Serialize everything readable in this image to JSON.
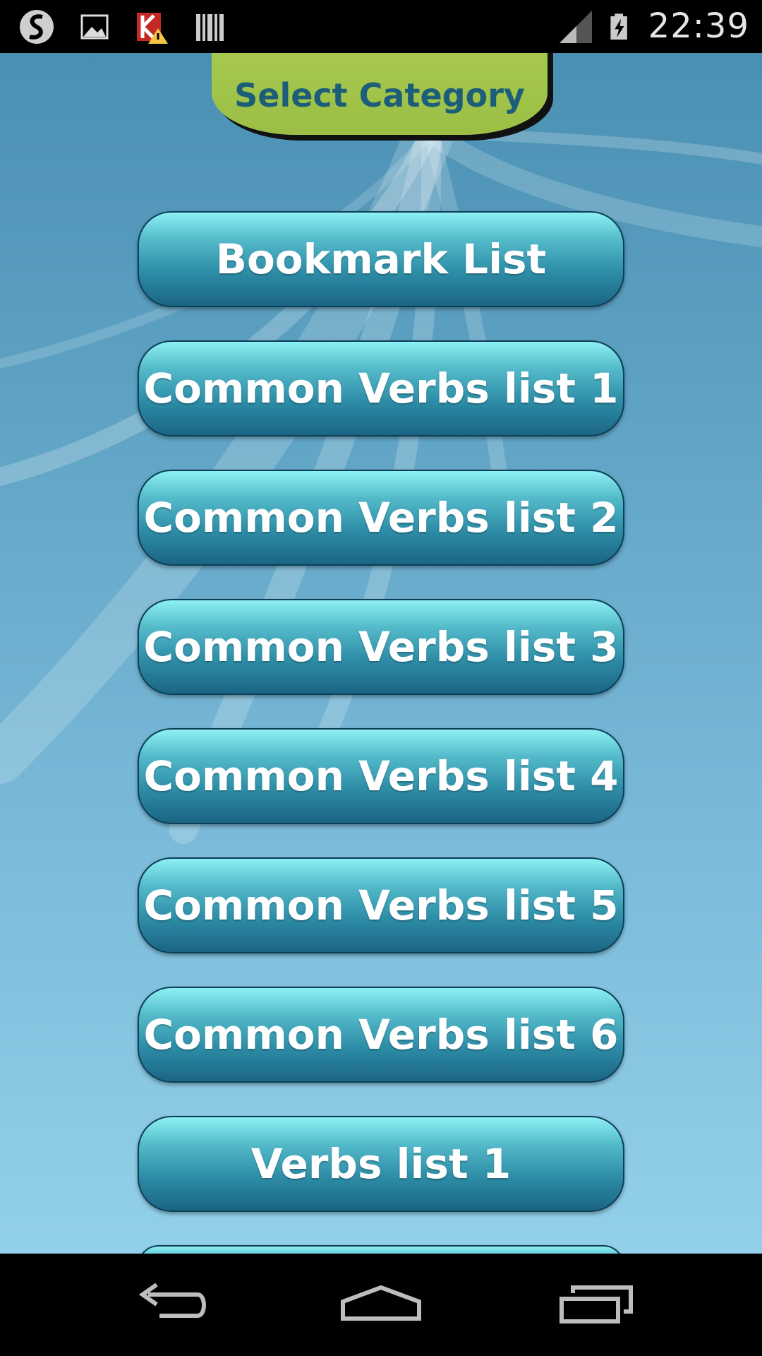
{
  "status_bar": {
    "time": "22:39",
    "left_icons": [
      "s-app-icon",
      "image-icon",
      "kaspersky-warning-icon",
      "barcode-icon"
    ],
    "right_icons": [
      "signal-icon",
      "battery-charging-icon"
    ]
  },
  "header": {
    "title": "Select Category"
  },
  "categories": [
    {
      "label": "Bookmark List"
    },
    {
      "label": "Common Verbs list 1"
    },
    {
      "label": "Common Verbs list 2"
    },
    {
      "label": "Common Verbs list 3"
    },
    {
      "label": "Common Verbs list 4"
    },
    {
      "label": "Common Verbs list 5"
    },
    {
      "label": "Common Verbs list 6"
    },
    {
      "label": "Verbs list 1"
    }
  ],
  "navigation": {
    "buttons": [
      "back-icon",
      "home-icon",
      "recent-apps-icon"
    ]
  },
  "colors": {
    "tab_green": "#a7c94f",
    "tab_text": "#1c5e7a",
    "button_top": "#8df0f4",
    "button_bottom": "#1a6584"
  }
}
